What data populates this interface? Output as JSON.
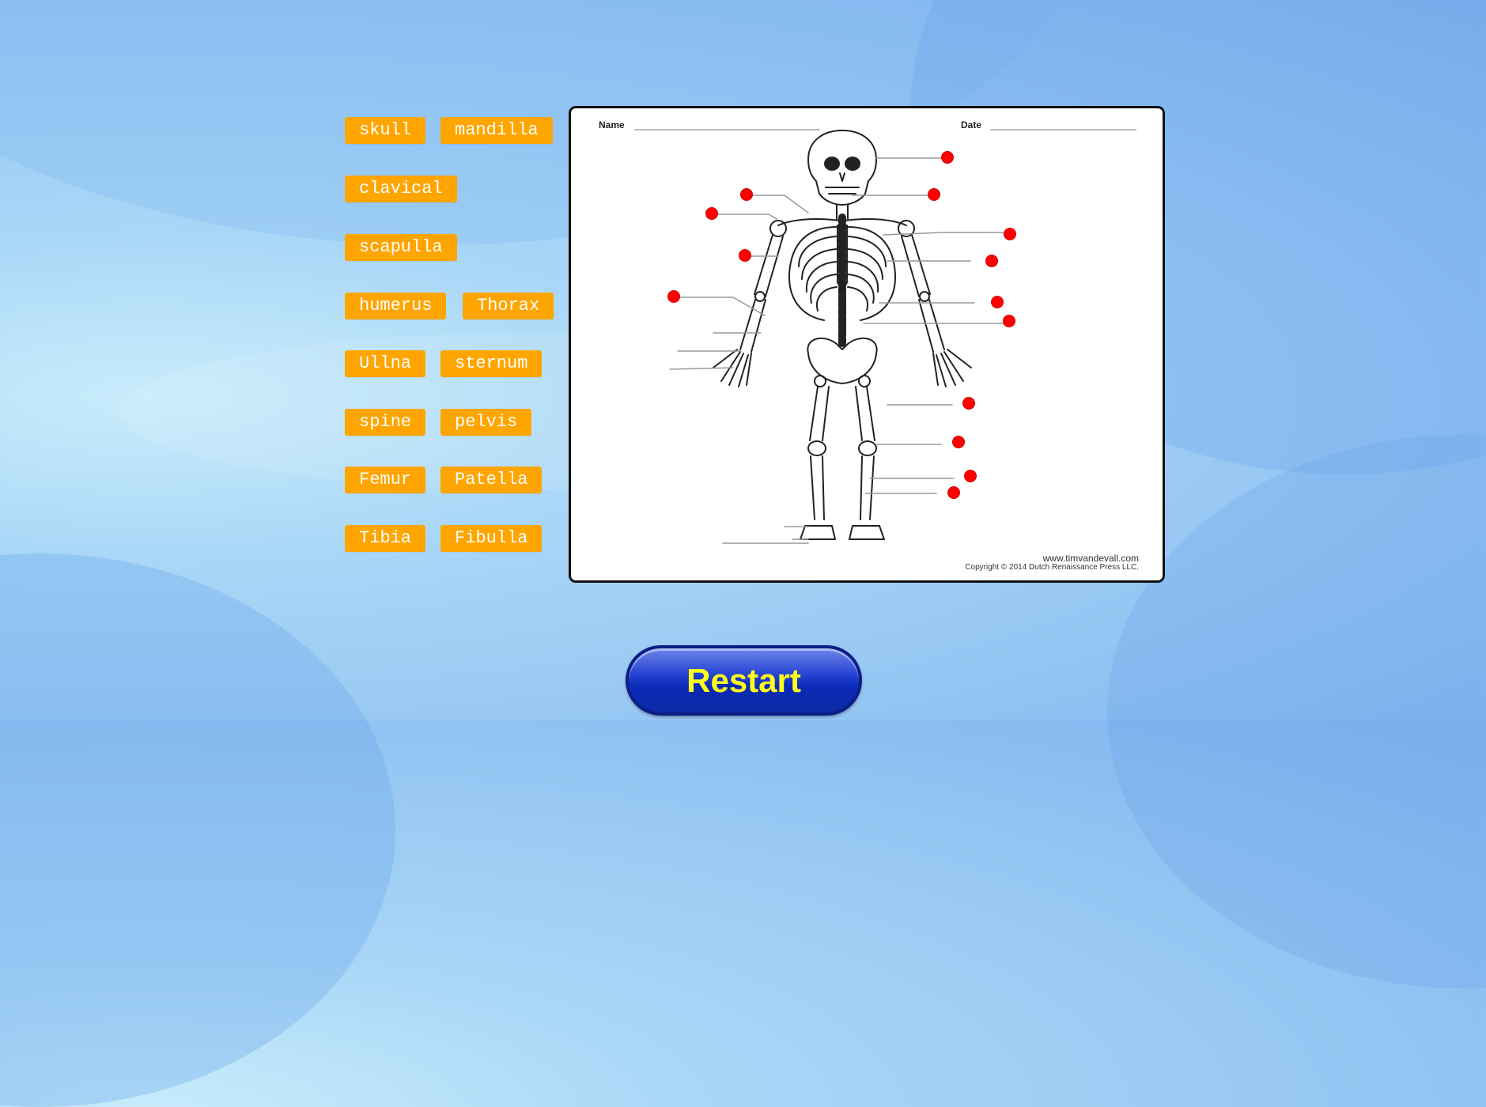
{
  "word_bank": [
    "skull",
    "mandilla",
    "clavical",
    "scapulla",
    "humerus",
    "Thorax",
    "Ullna",
    "sternum",
    "spine",
    "pelvis",
    "Femur",
    "Patella",
    "Tibia",
    "Fibulla"
  ],
  "worksheet": {
    "name_label": "Name",
    "date_label": "Date",
    "website": "www.timvandevall.com",
    "copyright": "Copyright © 2014 Dutch Renaissance Press LLC."
  },
  "restart_label": "Restart",
  "colors": {
    "chip": "#ffa500",
    "chip_text": "#ffffff",
    "target_dot": "#ff0000",
    "restart_text": "#ffff1a",
    "restart_bg": "#0a2ab8"
  }
}
